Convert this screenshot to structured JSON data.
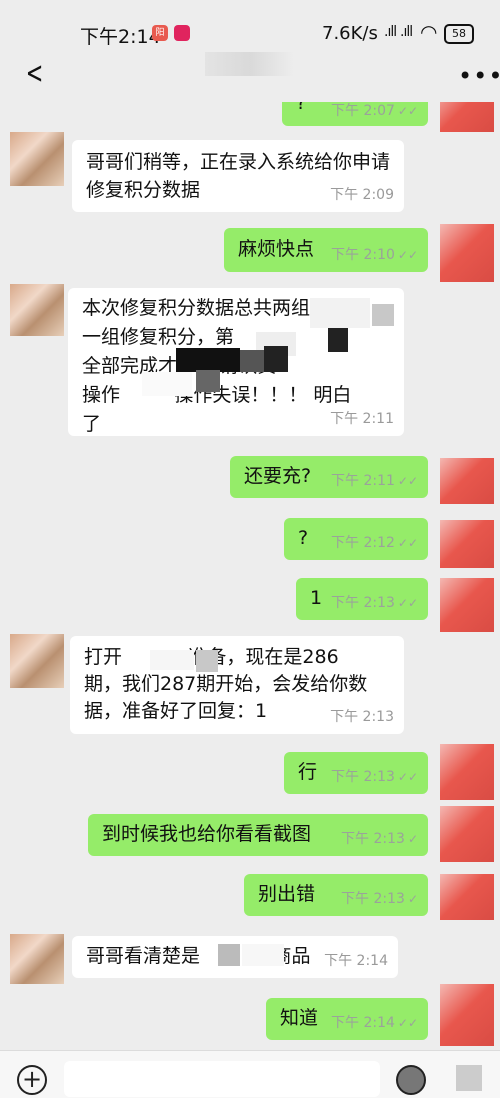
{
  "status_bar": {
    "time": "下午2:14",
    "app_icon1_label": "阳",
    "network_speed": "7.6K/s",
    "signal": ".ıll",
    "battery": "58"
  },
  "nav": {
    "back_icon": "chevron-left-icon",
    "more_icon": "more-dots-icon",
    "back_glyph": "<",
    "more_glyph": "•••"
  },
  "messages": [
    {
      "from": "me",
      "text": "?",
      "time": "下午 2:07",
      "read": true
    },
    {
      "from": "them",
      "text": "哥哥们稍等，正在录入系统给你申请\n修复积分数据",
      "time": "下午 2:09"
    },
    {
      "from": "me",
      "text": "麻烦快点",
      "time": "下午 2:10",
      "read": true
    },
    {
      "from": "them",
      "text": "本次修复积分数据总共两组\n一组修复积分，第\n全部完成才       请认真\n操作         操作失误！！！ 明白\n了",
      "time": "下午 2:11"
    },
    {
      "from": "me",
      "text": "还要充?",
      "time": "下午 2:11",
      "read": true
    },
    {
      "from": "me",
      "text": "?",
      "time": "下午 2:12",
      "read": true
    },
    {
      "from": "me",
      "text": "1",
      "time": "下午 2:13",
      "read": true
    },
    {
      "from": "them",
      "text": "打开           准备，现在是286\n期，我们287期开始，会发给你数\n据，准备好了回复：1",
      "time": "下午 2:13"
    },
    {
      "from": "me",
      "text": "行",
      "time": "下午 2:13",
      "read": true
    },
    {
      "from": "me",
      "text": "到时候我也给你看看截图",
      "time": "下午 2:13",
      "read": true
    },
    {
      "from": "me",
      "text": "别出错",
      "time": "下午 2:13",
      "read": true
    },
    {
      "from": "them",
      "text": "哥哥看清楚是            商品",
      "time": "下午 2:14"
    },
    {
      "from": "me",
      "text": "知道",
      "time": "下午 2:14",
      "read": true
    }
  ],
  "input_bar": {
    "plus_glyph": "+",
    "input_value": "",
    "left_icon": "plus-circle-icon",
    "right_icons": [
      "emoji-icon",
      "sticker-icon"
    ]
  },
  "colors": {
    "me_bubble": "#95ec69",
    "them_bubble": "#ffffff",
    "background": "#ededed"
  }
}
